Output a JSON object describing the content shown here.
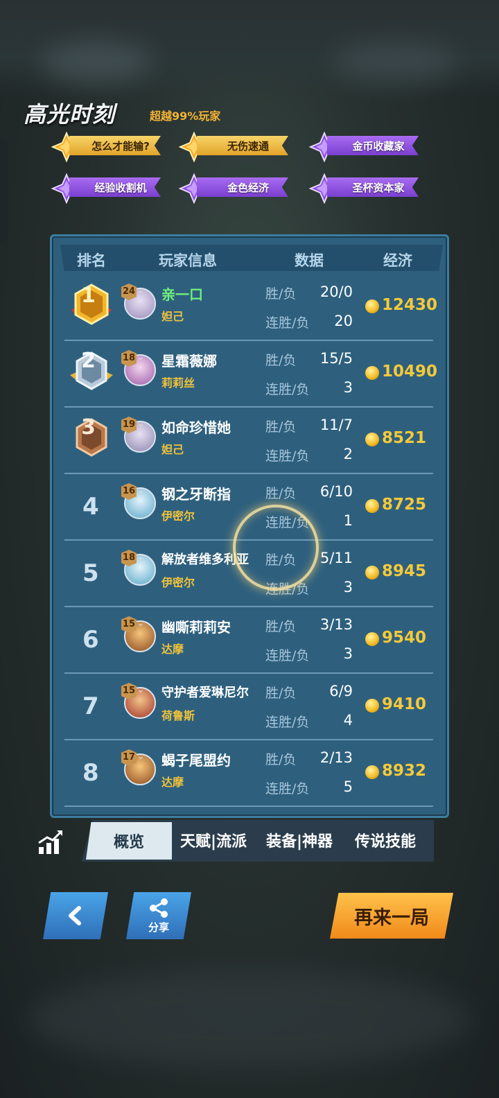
{
  "highlights": {
    "title": "高光时刻",
    "subtitle": "超越99%玩家",
    "badges": [
      {
        "label": "怎么才能输?",
        "style": "gold"
      },
      {
        "label": "无伤速通",
        "style": "gold"
      },
      {
        "label": "金币收藏家",
        "style": "purple"
      },
      {
        "label": "经验收割机",
        "style": "purple"
      },
      {
        "label": "金色经济",
        "style": "purple"
      },
      {
        "label": "圣杯资本家",
        "style": "purple"
      }
    ]
  },
  "table": {
    "headers": [
      "排名",
      "玩家信息",
      "数据",
      "经济"
    ],
    "stat_label_1": "胜/负",
    "stat_label_2": "连胜/负",
    "rows": [
      {
        "rank": "1",
        "level": "24",
        "name": "亲一口",
        "hero": "妲己",
        "wl": "20/0",
        "streak": "20",
        "gold": "12430",
        "me": true
      },
      {
        "rank": "2",
        "level": "18",
        "name": "星霜薇娜",
        "hero": "莉莉丝",
        "wl": "15/5",
        "streak": "3",
        "gold": "10490"
      },
      {
        "rank": "3",
        "level": "19",
        "name": "如命珍惜她",
        "hero": "妲己",
        "wl": "11/7",
        "streak": "2",
        "gold": "8521"
      },
      {
        "rank": "4",
        "level": "16",
        "name": "钢之牙断指",
        "hero": "伊密尔",
        "wl": "6/10",
        "streak": "1",
        "gold": "8725"
      },
      {
        "rank": "5",
        "level": "18",
        "name": "解放者维多利亚",
        "hero": "伊密尔",
        "wl": "5/11",
        "streak": "3",
        "gold": "8945"
      },
      {
        "rank": "6",
        "level": "15",
        "name": "幽嘶莉莉安",
        "hero": "达摩",
        "wl": "3/13",
        "streak": "3",
        "gold": "9540"
      },
      {
        "rank": "7",
        "level": "15",
        "name": "守护者爱琳尼尔",
        "hero": "荷鲁斯",
        "wl": "6/9",
        "streak": "4",
        "gold": "9410"
      },
      {
        "rank": "8",
        "level": "17",
        "name": "蝎子尾盟约",
        "hero": "达摩",
        "wl": "2/13",
        "streak": "5",
        "gold": "8932"
      }
    ]
  },
  "tabs": [
    "概览",
    "天赋|流派",
    "装备|神器",
    "传说技能"
  ],
  "buttons": {
    "share": "分享",
    "again": "再来一局"
  },
  "colors": {
    "panel": "#2e607e",
    "gold_text": "#f5c93a",
    "hero_text": "#f0c23a",
    "me_text": "#6ff07a"
  }
}
